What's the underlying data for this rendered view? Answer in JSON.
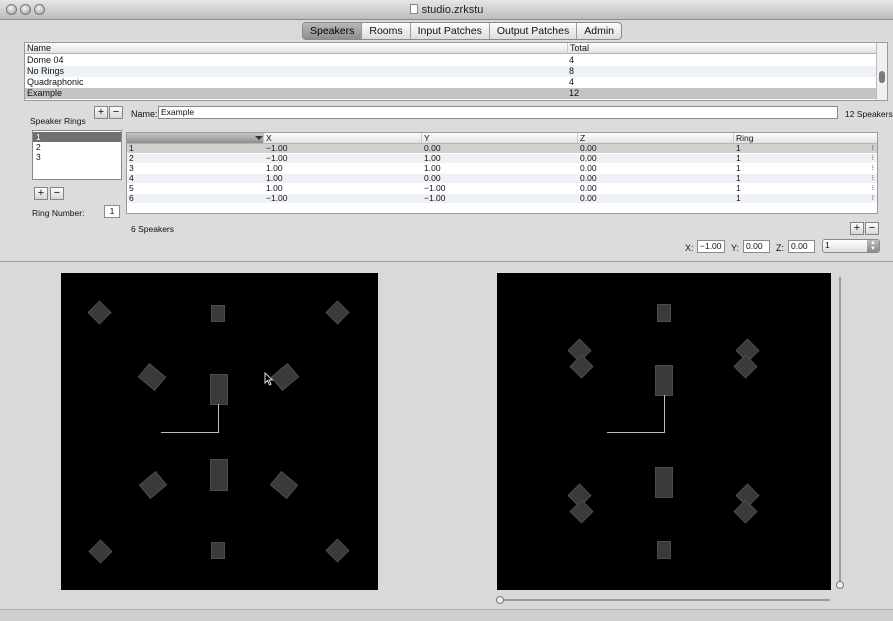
{
  "window": {
    "title": "studio.zrkstu"
  },
  "tabs": [
    {
      "label": "Speakers",
      "active": true
    },
    {
      "label": "Rooms",
      "active": false
    },
    {
      "label": "Input Patches",
      "active": false
    },
    {
      "label": "Output Patches",
      "active": false
    },
    {
      "label": "Admin",
      "active": false
    }
  ],
  "patch_table": {
    "headers": {
      "name": "Name",
      "total": "Total"
    },
    "rows": [
      {
        "name": "Dome 04",
        "total": "4"
      },
      {
        "name": "No Rings",
        "total": "8"
      },
      {
        "name": "Quadraphonic",
        "total": "4"
      },
      {
        "name": "Example",
        "total": "12",
        "selected": true
      }
    ]
  },
  "editor": {
    "add_label": "+",
    "remove_label": "−",
    "name_label": "Name:",
    "name_value": "Example",
    "speaker_count_label": "12 Speakers"
  },
  "rings": {
    "section_label": "Speaker Rings",
    "items": [
      "1",
      "2",
      "3"
    ],
    "selected_index": 0,
    "add_label": "+",
    "remove_label": "−",
    "ring_number_label": "Ring Number:",
    "ring_number_value": "1"
  },
  "speakers_table": {
    "headers": {
      "num": "",
      "x": "X",
      "y": "Y",
      "z": "Z",
      "ring": "Ring"
    },
    "rows": [
      {
        "num": "1",
        "x": "−1.00",
        "y": "0.00",
        "z": "0.00",
        "ring": "1"
      },
      {
        "num": "2",
        "x": "−1.00",
        "y": "1.00",
        "z": "0.00",
        "ring": "1"
      },
      {
        "num": "3",
        "x": "1.00",
        "y": "1.00",
        "z": "0.00",
        "ring": "1"
      },
      {
        "num": "4",
        "x": "1.00",
        "y": "0.00",
        "z": "0.00",
        "ring": "1"
      },
      {
        "num": "5",
        "x": "1.00",
        "y": "−1.00",
        "z": "0.00",
        "ring": "1"
      },
      {
        "num": "6",
        "x": "−1.00",
        "y": "−1.00",
        "z": "0.00",
        "ring": "1"
      }
    ],
    "count_label": "6  Speakers",
    "add_label": "+",
    "remove_label": "−"
  },
  "coords": {
    "x_label": "X:",
    "x_value": "−1.00",
    "y_label": "Y:",
    "y_value": "0.00",
    "z_label": "Z:",
    "z_value": "0.00",
    "ring_select_value": "1"
  },
  "icons": {
    "close": "close-icon",
    "minimize": "minimize-icon",
    "zoom": "zoom-icon",
    "cursor": "mouse-pointer-icon",
    "document": "document-icon"
  }
}
